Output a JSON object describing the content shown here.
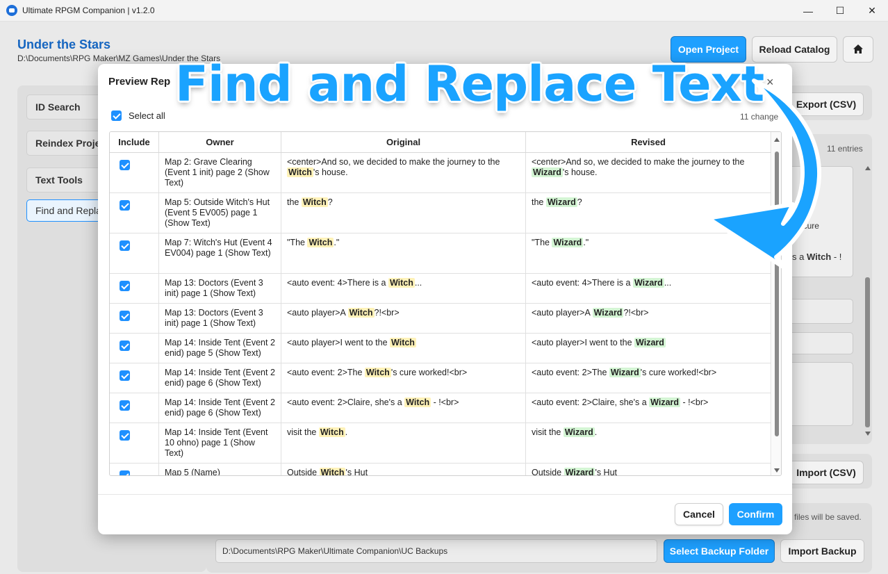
{
  "window": {
    "title": "Ultimate RPGM Companion | v1.2.0",
    "minimize": "—",
    "maximize": "☐",
    "close": "✕"
  },
  "project": {
    "name": "Under the Stars",
    "path": "D:\\Documents\\RPG Maker\\MZ Games\\Under the Stars"
  },
  "top_buttons": {
    "open_project": "Open Project",
    "reload_catalog": "Reload Catalog",
    "home_icon": "home-icon"
  },
  "sidebar": {
    "items": [
      {
        "label": "ID Search"
      },
      {
        "label": "Reindex Projec"
      },
      {
        "label": "Text Tools"
      },
      {
        "label": "Find and Replac"
      }
    ]
  },
  "background": {
    "export_csv": "Export (CSV)",
    "entries": "11 entries",
    "frag_cure": "'s cure",
    "frag_witch_prefix": "s a ",
    "frag_witch_word": "Witch",
    "frag_witch_suffix": " - !",
    "import_csv": "Import (CSV)",
    "backup_note": "files will be saved.",
    "backup_path": "D:\\Documents\\RPG Maker\\Ultimate Companion\\UC Backups",
    "select_backup_folder": "Select Backup Folder",
    "import_backup": "Import Backup"
  },
  "modal": {
    "title": "Preview Rep",
    "close": "×",
    "select_all": "Select all",
    "change_count": "11 change",
    "headers": {
      "include": "Include",
      "owner": "Owner",
      "original": "Original",
      "revised": "Revised"
    },
    "rows": [
      {
        "owner": "Map 2: Grave Clearing (Event 1 init) page 2 (Show Text)",
        "o_pre": "<center>And so, we decided to make the journey to the ",
        "o_hl": "Witch",
        "o_post": "'s house.",
        "r_pre": "<center>And so, we decided to make the journey to the ",
        "r_hl": "Wizard",
        "r_post": "'s house."
      },
      {
        "owner": "Map 5: Outside Witch's Hut (Event 5 EV005) page 1 (Show Text)",
        "o_pre": "the ",
        "o_hl": "Witch",
        "o_post": "?",
        "r_pre": "the ",
        "r_hl": "Wizard",
        "r_post": "?"
      },
      {
        "owner": "Map 7: Witch's Hut (Event 4 EV004) page 1 (Show Text)",
        "o_pre": "\"The ",
        "o_hl": "Witch",
        "o_post": ".\"",
        "r_pre": "\"The ",
        "r_hl": "Wizard",
        "r_post": ".\""
      },
      {
        "owner": "Map 13: Doctors (Event 3 init) page 1 (Show Text)",
        "o_pre": "<auto event: 4>There is a ",
        "o_hl": "Witch",
        "o_post": "...",
        "r_pre": "<auto event: 4>There is a ",
        "r_hl": "Wizard",
        "r_post": "..."
      },
      {
        "owner": "Map 13: Doctors (Event 3 init) page 1 (Show Text)",
        "o_pre": "<auto player>A ",
        "o_hl": "Witch",
        "o_post": "?!<br>",
        "r_pre": "<auto player>A ",
        "r_hl": "Wizard",
        "r_post": "?!<br>"
      },
      {
        "owner": "Map 14: Inside Tent (Event 2 enid) page 5 (Show Text)",
        "o_pre": "<auto player>I went to the ",
        "o_hl": "Witch",
        "o_post": "",
        "r_pre": "<auto player>I went to the ",
        "r_hl": "Wizard",
        "r_post": ""
      },
      {
        "owner": "Map 14: Inside Tent (Event 2 enid) page 6 (Show Text)",
        "o_pre": "<auto event: 2>The ",
        "o_hl": "Witch",
        "o_post": "'s cure worked!<br>",
        "r_pre": "<auto event: 2>The ",
        "r_hl": "Wizard",
        "r_post": "'s cure worked!<br>"
      },
      {
        "owner": "Map 14: Inside Tent (Event 2 enid) page 6 (Show Text)",
        "o_pre": "<auto event: 2>Claire, she's a ",
        "o_hl": "Witch",
        "o_post": " - !<br>",
        "r_pre": "<auto event: 2>Claire, she's a ",
        "r_hl": "Wizard",
        "r_post": " - !<br>"
      },
      {
        "owner": "Map 14: Inside Tent (Event 10 ohno) page 1 (Show Text)",
        "o_pre": "visit the ",
        "o_hl": "Witch",
        "o_post": ".",
        "r_pre": "visit the ",
        "r_hl": "Wizard",
        "r_post": "."
      },
      {
        "owner": "Map 5 (Name)",
        "o_pre": "Outside ",
        "o_hl": "Witch",
        "o_post": "'s Hut",
        "r_pre": "Outside ",
        "r_hl": "Wizard",
        "r_post": "'s Hut"
      }
    ],
    "cancel": "Cancel",
    "confirm": "Confirm"
  },
  "overlay": {
    "headline": "Find and Replace Text",
    "arrow_color": "#1aa3ff"
  }
}
